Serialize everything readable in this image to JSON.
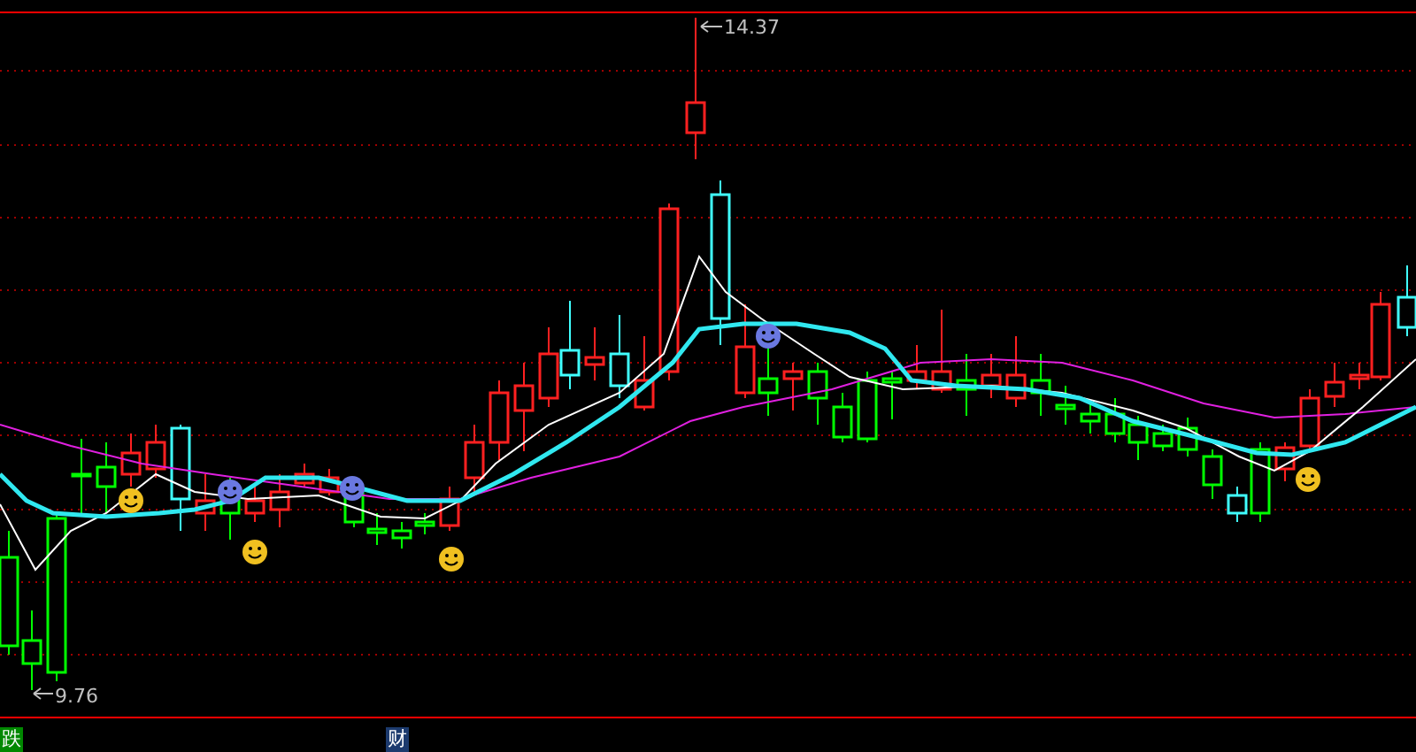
{
  "chart": {
    "high_label": "14.37",
    "low_label": "9.76"
  },
  "bottom_bar": {
    "tabs": [
      {
        "label": "跌",
        "color": "#008800"
      },
      {
        "label": "财",
        "color": "#1c3a6e"
      }
    ]
  }
}
